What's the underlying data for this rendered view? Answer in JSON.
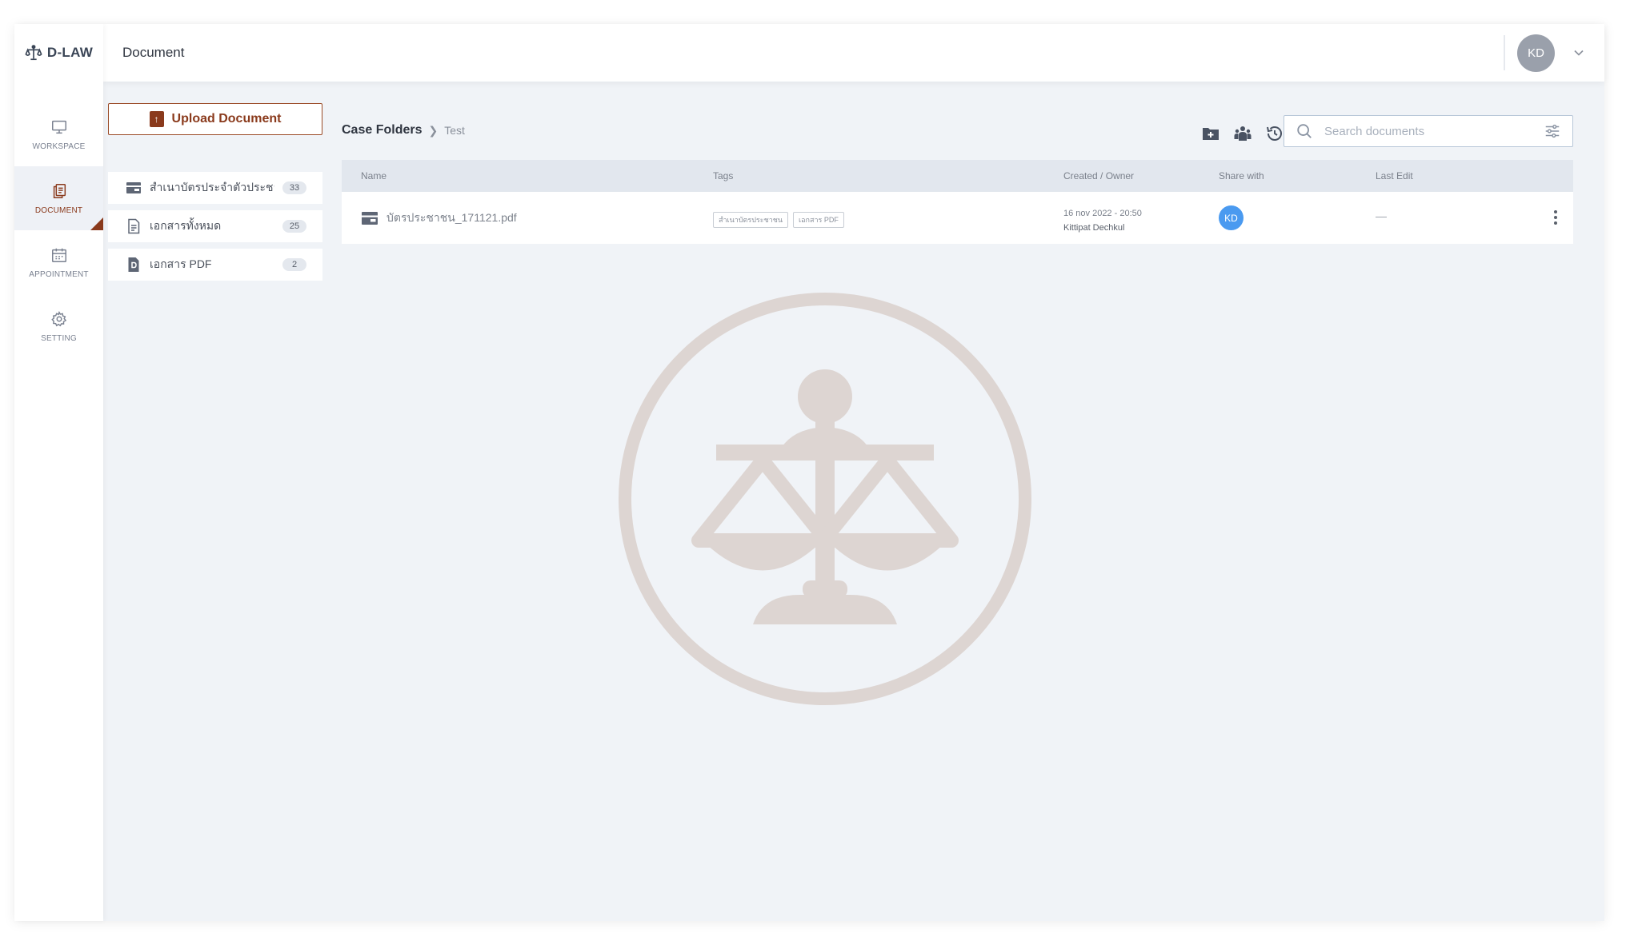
{
  "app": {
    "logo_text": "D-LAW"
  },
  "sidebar": {
    "items": [
      {
        "label": "WORKSPACE",
        "icon": "monitor-icon"
      },
      {
        "label": "DOCUMENT",
        "icon": "documents-icon",
        "active": true
      },
      {
        "label": "APPOINTMENT",
        "icon": "calendar-icon"
      },
      {
        "label": "SETTING",
        "icon": "gear-icon"
      }
    ]
  },
  "header": {
    "title": "Document",
    "user_initials": "KD"
  },
  "folders": {
    "upload_label": "Upload Document",
    "items": [
      {
        "name": "สำเนาบัตรประจำตัวประชาชน",
        "count": "33",
        "icon": "id-card-icon"
      },
      {
        "name": "เอกสารทั้งหมด",
        "count": "25",
        "icon": "file-icon"
      },
      {
        "name": "เอกสาร PDF",
        "count": "2",
        "icon": "pdf-icon"
      }
    ]
  },
  "breadcrumb": {
    "root": "Case Folders",
    "current": "Test"
  },
  "toolbar": {
    "search_placeholder": "Search documents"
  },
  "table": {
    "columns": [
      "Name",
      "Tags",
      "Created / Owner",
      "Share with",
      "Last Edit"
    ],
    "rows": [
      {
        "name": "บัตรประชาชน_171121.pdf",
        "tags": [
          "สำเนาบัตรประชาชน",
          "เอกสาร PDF"
        ],
        "created": "16 nov 2022 - 20:50",
        "owner": "Kittipat Dechkul",
        "share_initials": "KD",
        "last_edit": "—"
      }
    ]
  },
  "colors": {
    "accent": "#8a3a1c",
    "background": "#f0f3f7",
    "share_avatar": "#4a9af0",
    "watermark": "#ddd5d2"
  }
}
